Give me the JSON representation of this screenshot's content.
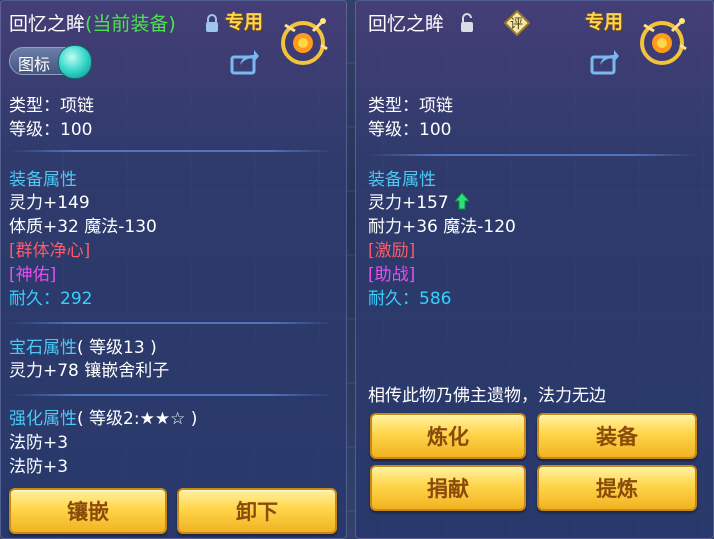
{
  "left_panel": {
    "title_name": "回忆之眸",
    "title_status": "(当前装备)",
    "exclusive": "专用",
    "toggle_label": "图标",
    "type_line": "类型：项链",
    "level_line": "等级：100",
    "equip_header": "装备属性",
    "attrs": [
      "灵力+149",
      "体质+32 魔法-130"
    ],
    "special1": "[群体净心]",
    "special2": "[神佑]",
    "durability_label": "耐久：",
    "durability_value": "292",
    "gem_header": "宝石属性",
    "gem_level": "( 等级13 )",
    "gem_line": "灵力+78 镶嵌舍利子",
    "enhance_header": "强化属性",
    "enhance_level": "( 等级2:★★☆ )",
    "enhance_lines": [
      "法防+3",
      "法防+3"
    ],
    "buttons": [
      "镶嵌",
      "卸下"
    ]
  },
  "right_panel": {
    "title_name": "回忆之眸",
    "eval_badge": "评",
    "exclusive": "专用",
    "type_line": "类型：项链",
    "level_line": "等级：100",
    "equip_header": "装备属性",
    "attr1": "灵力+157",
    "attr2": "耐力+36 魔法-120",
    "special1": "[激励]",
    "special2": "[助战]",
    "durability_label": "耐久：",
    "durability_value": "586",
    "description": "相传此物乃佛主遗物，法力无边",
    "buttons": [
      "炼化",
      "装备",
      "捐献",
      "提炼"
    ]
  },
  "colors": {
    "section": "#4dc8f5",
    "special_red": "#ff5a6a",
    "special_magenta": "#e84cf0",
    "durability": "#35d0ff",
    "equipped": "#4fe04f",
    "exclusive": "#ffd44a",
    "button_gold": "#ffd54a"
  },
  "icons": [
    "lock-icon",
    "unlock-icon",
    "share-icon",
    "eval-badge-icon",
    "exclusive-seal-icon",
    "arrow-up-icon"
  ]
}
